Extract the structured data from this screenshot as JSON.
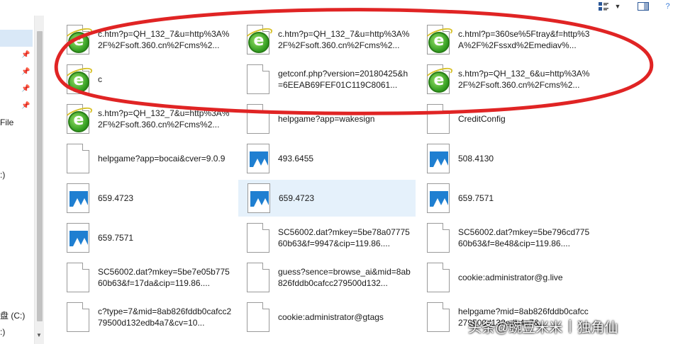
{
  "toolbar": {
    "icons": [
      "view-options-icon",
      "chevron-down-icon",
      "preview-pane-icon",
      "help-icon"
    ],
    "help_glyph": "?"
  },
  "nav": {
    "labels": [
      "File",
      ":)",
      "盘 (C:)",
      ":)"
    ]
  },
  "files": [
    {
      "icon": "html-icon",
      "name": "c.htm?p=QH_132_7&u=http%3A%2F%2Fsoft.360.cn%2Fcms%2..."
    },
    {
      "icon": "html-icon",
      "name": "c.htm?p=QH_132_7&u=http%3A%2F%2Fsoft.360.cn%2Fcms%2..."
    },
    {
      "icon": "html-icon",
      "name": "c.html?p=360se%5Ftray&f=http%3A%2F%2Fssxd%2Emediav%..."
    },
    {
      "icon": "html-icon",
      "name": "c"
    },
    {
      "icon": "file-icon",
      "name": "getconf.php?version=20180425&h=6EEAB69FEF01C119C8061..."
    },
    {
      "icon": "html-icon",
      "name": "s.htm?p=QH_132_6&u=http%3A%2F%2Fsoft.360.cn%2Fcms%2..."
    },
    {
      "icon": "html-icon",
      "name": "s.htm?p=QH_132_7&u=http%3A%2F%2Fsoft.360.cn%2Fcms%2..."
    },
    {
      "icon": "file-icon",
      "name": "helpgame?app=wakesign"
    },
    {
      "icon": "file-icon",
      "name": "CreditConfig"
    },
    {
      "icon": "file-icon",
      "name": "helpgame?app=bocai&cver=9.0.9"
    },
    {
      "icon": "image-icon",
      "name": "493.6455"
    },
    {
      "icon": "image-icon",
      "name": "508.4130"
    },
    {
      "icon": "image-icon",
      "name": "659.4723"
    },
    {
      "icon": "image-icon",
      "name": "659.4723",
      "selected": true
    },
    {
      "icon": "image-icon",
      "name": "659.7571"
    },
    {
      "icon": "image-icon",
      "name": "659.7571"
    },
    {
      "icon": "file-icon",
      "name": "SC56002.dat?mkey=5be78a0777560b63&f=9947&cip=119.86...."
    },
    {
      "icon": "file-icon",
      "name": "SC56002.dat?mkey=5be796cd77560b63&f=8e48&cip=119.86...."
    },
    {
      "icon": "file-icon",
      "name": "SC56002.dat?mkey=5be7e05b77560b63&f=17da&cip=119.86...."
    },
    {
      "icon": "file-icon",
      "name": "guess?sence=browse_ai&mid=8ab826fddb0cafcc279500d132..."
    },
    {
      "icon": "file-icon",
      "name": "cookie:administrator@g.live"
    },
    {
      "icon": "file-icon",
      "name": "c?type=7&mid=8ab826fddb0cafcc279500d132edb4a7&cv=10..."
    },
    {
      "icon": "file-icon",
      "name": "cookie:administrator@gtags"
    },
    {
      "icon": "file-icon",
      "name": "helpgame?mid=8ab826fddb0cafcc279500d132edb4a7&..."
    }
  ],
  "annotation": {
    "color": "#e02424"
  },
  "watermark": {
    "left": "头条",
    "handle": "@豌豆米米",
    "separator": "|",
    "right": "独角仙"
  },
  "colors": {
    "selection": "#e5f1fb",
    "nav_selection": "#d9e8f7",
    "image_blue": "#1f7fd1",
    "ie_green": "#2f9a1e"
  }
}
